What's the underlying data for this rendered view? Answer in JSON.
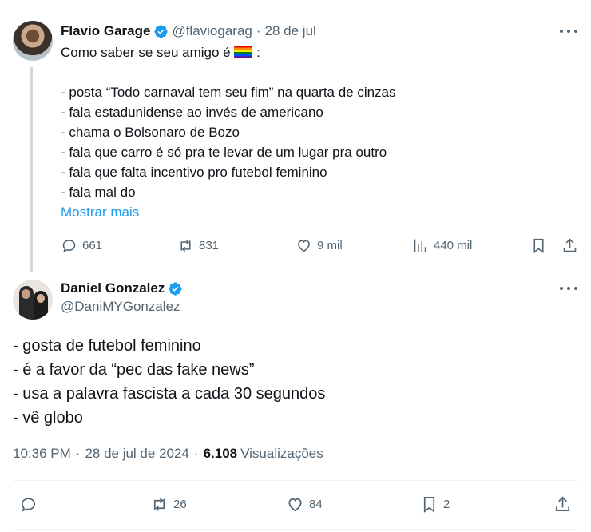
{
  "parent": {
    "name": "Flavio Garage",
    "handle": "@flaviogarag",
    "dot": "·",
    "date": "28 de jul",
    "lines": [
      "Como saber se seu amigo é",
      "",
      "- posta “Todo carnaval tem seu fim” na quarta de cinzas",
      "- fala estadunidense ao invés de americano",
      "- chama o Bolsonaro de Bozo",
      "- fala que carro é só pra te levar de um lugar pra outro",
      "- fala que falta incentivo pro futebol feminino",
      "- fala mal do"
    ],
    "emoji_suffix": " :",
    "show_more": "Mostrar mais",
    "actions": {
      "replies": "661",
      "reposts": "831",
      "likes": "9 mil",
      "views": "440 mil"
    }
  },
  "main": {
    "name": "Daniel Gonzalez",
    "handle": "@DaniMYGonzalez",
    "lines": [
      "- gosta de futebol feminino",
      "- é a favor da “pec das fake news”",
      "- usa a palavra fascista a cada 30 segundos",
      "- vê globo"
    ],
    "time": "10:36 PM",
    "sep": "·",
    "date": "28 de jul de 2024",
    "sep2": "·",
    "views_count": "6.108",
    "views_label": "Visualizações",
    "actions": {
      "replies": "",
      "reposts": "26",
      "likes": "84",
      "bookmarks": "2"
    }
  },
  "colors": {
    "verified": "#1d9bf0",
    "link": "#1d9bf0",
    "muted": "#536471"
  },
  "icons": [
    "verified-badge-icon",
    "more-icon",
    "reply-icon",
    "repost-icon",
    "like-icon",
    "views-icon",
    "bookmark-icon",
    "share-icon",
    "rainbow-flag-emoji"
  ]
}
